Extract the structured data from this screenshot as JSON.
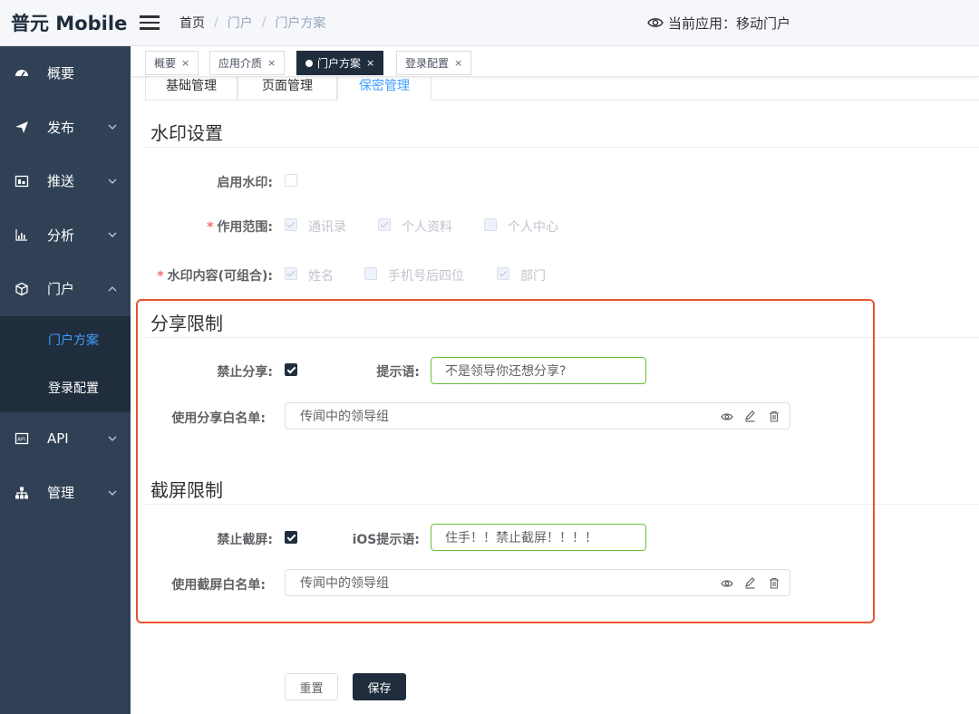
{
  "brand": "普元 Mobile",
  "sidebar": {
    "items": [
      {
        "label": "概要",
        "icon": "dashboard-icon"
      },
      {
        "label": "发布",
        "icon": "send-icon"
      },
      {
        "label": "推送",
        "icon": "push-icon"
      },
      {
        "label": "分析",
        "icon": "chart-icon"
      },
      {
        "label": "门户",
        "icon": "cube-icon"
      },
      {
        "label": "API",
        "icon": "api-icon"
      },
      {
        "label": "管理",
        "icon": "sitemap-icon"
      }
    ],
    "submenu": [
      {
        "label": "门户方案",
        "active": true
      },
      {
        "label": "登录配置",
        "active": false
      }
    ]
  },
  "header": {
    "breadcrumb": [
      "首页",
      "门户",
      "门户方案"
    ],
    "current_app": "当前应用：移动门户"
  },
  "tags": [
    {
      "label": "概要",
      "active": false
    },
    {
      "label": "应用介质",
      "active": false
    },
    {
      "label": "门户方案",
      "active": true
    },
    {
      "label": "登录配置",
      "active": false
    }
  ],
  "subtabs": [
    "基础管理",
    "页面管理",
    "保密管理"
  ],
  "watermark": {
    "title": "水印设置",
    "enable_label": "启用水印:",
    "scope_label": "作用范围:",
    "scope_options": [
      "通讯录",
      "个人资料",
      "个人中心"
    ],
    "content_label": "水印内容(可组合):",
    "content_options": [
      "姓名",
      "手机号后四位",
      "部门"
    ]
  },
  "share": {
    "title": "分享限制",
    "forbid_label": "禁止分享:",
    "hint_label": "提示语:",
    "hint_value": "不是领导你还想分享?",
    "whitelist_label": "使用分享白名单:",
    "whitelist_value": "传闻中的领导组"
  },
  "screenshot": {
    "title": "截屏限制",
    "forbid_label": "禁止截屏:",
    "hint_label": "iOS提示语:",
    "hint_value": "住手！！禁止截屏！！！！",
    "whitelist_label": "使用截屏白名单:",
    "whitelist_value": "传闻中的领导组"
  },
  "buttons": {
    "reset": "重置",
    "save": "保存"
  },
  "colors": {
    "sidebar_bg": "#304156",
    "submenu_bg": "#1f2d3d",
    "active_link": "#409eff",
    "highlight_border": "#e8562f",
    "valid_input_border": "#67c23a"
  }
}
